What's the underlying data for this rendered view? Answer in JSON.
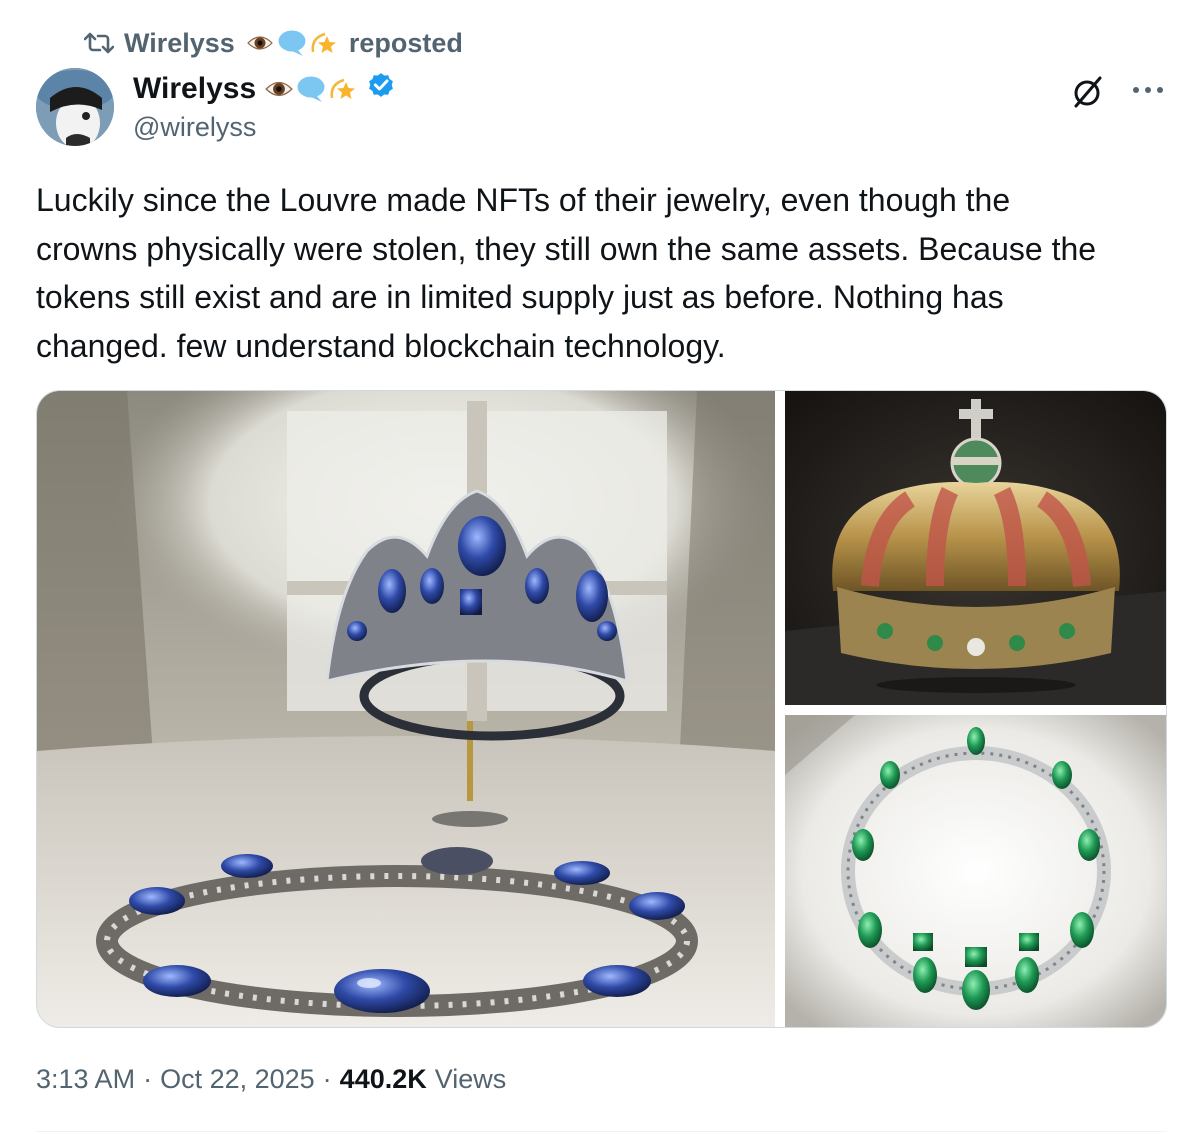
{
  "repost": {
    "reposter_name": "Wirelyss",
    "label": "reposted",
    "icon": "repost-icon"
  },
  "author": {
    "display_name": "Wirelyss",
    "handle": "@wirelyss",
    "verified": true,
    "name_emojis": [
      "eye-emoji",
      "speech-bubble-emoji",
      "dizzy-star-emoji"
    ],
    "badge_color": "#1d9bf0"
  },
  "header_actions": {
    "grok_icon": "grok-icon",
    "more_icon": "more-options-icon"
  },
  "tweet": {
    "lines": [
      "Luckily since the Louvre made NFTs of their jewelry, even though the",
      "crowns physically were stolen, they still own the same assets. Because the",
      "tokens still exist and are in limited supply just as before. Nothing has",
      "changed. few understand blockchain technology."
    ]
  },
  "media": [
    {
      "name": "sapphire-tiara-and-necklace-photo"
    },
    {
      "name": "gold-crown-photo"
    },
    {
      "name": "emerald-necklace-photo"
    }
  ],
  "meta": {
    "time": "3:13 AM",
    "separator": "·",
    "date": "Oct 22, 2025",
    "views_count": "440.2K",
    "views_label": "Views"
  },
  "colors": {
    "text_primary": "#0f1419",
    "text_secondary": "#536471",
    "accent": "#1d9bf0",
    "border": "#cfd9de"
  }
}
